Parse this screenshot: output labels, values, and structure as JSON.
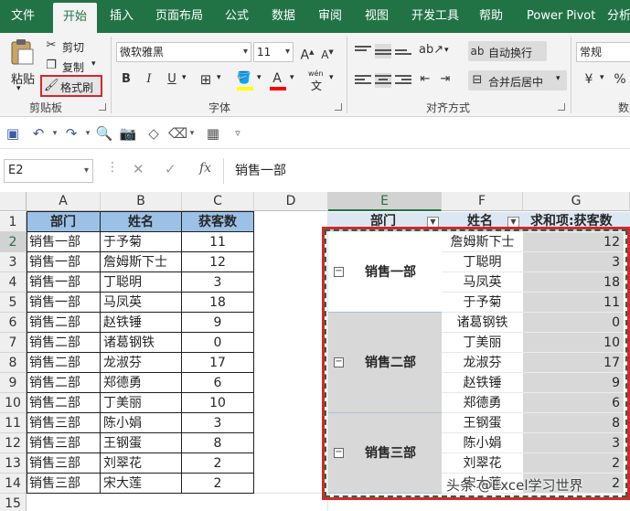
{
  "ribbon_tabs": [
    "文件",
    "开始",
    "插入",
    "页面布局",
    "公式",
    "数据",
    "审阅",
    "视图",
    "开发工具",
    "帮助",
    "Power Pivot",
    "分析"
  ],
  "active_tab": "开始",
  "clipboard": {
    "paste": "粘贴",
    "cut": "剪切",
    "copy": "复制",
    "format_painter": "格式刷",
    "group_label": "剪贴板"
  },
  "font": {
    "family": "微软雅黑",
    "size": "11",
    "bold": "B",
    "italic": "I",
    "underline": "U",
    "group_label": "字体",
    "phonetic": "wén"
  },
  "alignment": {
    "wrap_text": "自动换行",
    "merge_center": "合并后居中",
    "group_label": "对齐方式"
  },
  "number": {
    "format": "常规",
    "group_label": "数字"
  },
  "formula_bar": {
    "name_box": "E2",
    "fx": "fx",
    "content": "销售一部"
  },
  "columns": [
    "A",
    "B",
    "C",
    "D",
    "E",
    "F",
    "G"
  ],
  "rows": [
    "1",
    "2",
    "3",
    "4",
    "5",
    "6",
    "7",
    "8",
    "9",
    "10",
    "11",
    "12",
    "13",
    "14",
    "15"
  ],
  "source_table": {
    "headers": [
      "部门",
      "姓名",
      "获客数"
    ],
    "rows": [
      [
        "销售一部",
        "于予菊",
        "11"
      ],
      [
        "销售一部",
        "詹姆斯下士",
        "12"
      ],
      [
        "销售一部",
        "丁聪明",
        "3"
      ],
      [
        "销售一部",
        "马凤英",
        "18"
      ],
      [
        "销售二部",
        "赵铁锤",
        "9"
      ],
      [
        "销售二部",
        "诸葛钢铁",
        "0"
      ],
      [
        "销售二部",
        "龙淑芬",
        "17"
      ],
      [
        "销售二部",
        "郑德勇",
        "6"
      ],
      [
        "销售二部",
        "丁美丽",
        "10"
      ],
      [
        "销售三部",
        "陈小娟",
        "3"
      ],
      [
        "销售三部",
        "王钢蛋",
        "8"
      ],
      [
        "销售三部",
        "刘翠花",
        "2"
      ],
      [
        "销售三部",
        "宋大莲",
        "2"
      ]
    ]
  },
  "pivot_table": {
    "headers": [
      "部门",
      "姓名",
      "求和项:获客数"
    ],
    "groups": [
      {
        "dept": "销售一部",
        "rows": [
          [
            "詹姆斯下士",
            "12"
          ],
          [
            "丁聪明",
            "3"
          ],
          [
            "马凤英",
            "18"
          ],
          [
            "于予菊",
            "11"
          ]
        ]
      },
      {
        "dept": "销售二部",
        "rows": [
          [
            "诸葛钢铁",
            "0"
          ],
          [
            "丁美丽",
            "10"
          ],
          [
            "龙淑芬",
            "17"
          ],
          [
            "赵铁锤",
            "9"
          ],
          [
            "郑德勇",
            "6"
          ]
        ]
      },
      {
        "dept": "销售三部",
        "rows": [
          [
            "王钢蛋",
            "8"
          ],
          [
            "陈小娟",
            "3"
          ],
          [
            "刘翠花",
            "2"
          ],
          [
            "宋大莲",
            "2"
          ]
        ]
      }
    ]
  },
  "watermark": "头条 @Excel学习世界"
}
